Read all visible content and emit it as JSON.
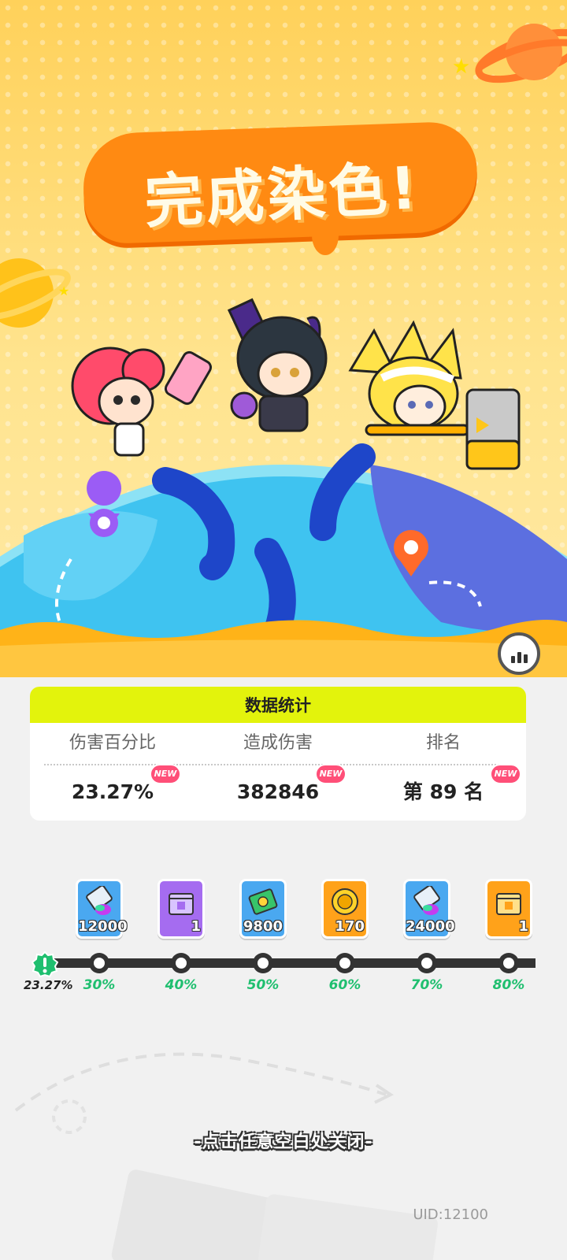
{
  "banner": {
    "title": "完成染色!"
  },
  "stats": {
    "header": "数据统计",
    "columns": [
      {
        "label": "伤害百分比",
        "value": "23.27%",
        "badge": "NEW"
      },
      {
        "label": "造成伤害",
        "value": "382846",
        "badge": "NEW"
      },
      {
        "label": "排名",
        "value": "第 89 名",
        "badge": "NEW"
      }
    ]
  },
  "progress": {
    "current_label": "23.27%",
    "current_value": 23.27,
    "milestones": [
      {
        "percent": "30%",
        "reward_icon": "paint-tube-icon",
        "reward_count": "12000"
      },
      {
        "percent": "40%",
        "reward_icon": "purple-gift-box-icon",
        "reward_count": "1"
      },
      {
        "percent": "50%",
        "reward_icon": "cash-icon",
        "reward_count": "9800"
      },
      {
        "percent": "60%",
        "reward_icon": "gold-coin-icon",
        "reward_count": "170"
      },
      {
        "percent": "70%",
        "reward_icon": "paint-tube-icon",
        "reward_count": "24000"
      },
      {
        "percent": "80%",
        "reward_icon": "orange-gift-box-icon",
        "reward_count": "1"
      }
    ]
  },
  "footer": {
    "close_hint": "-点击任意空白处关闭-",
    "uid": "UID:12100"
  },
  "colors": {
    "accent_yellow_green": "#e3f30c",
    "progress_green": "#1fbf6f",
    "title_orange": "#ff8a12"
  }
}
